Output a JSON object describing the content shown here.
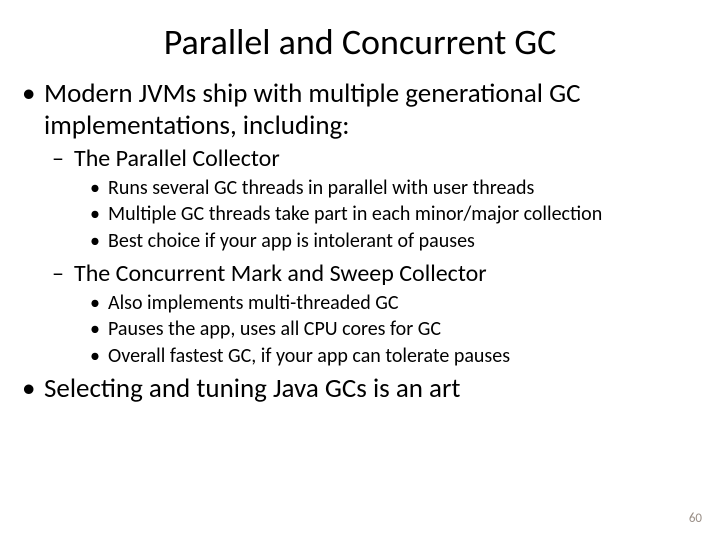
{
  "title": "Parallel and Concurrent GC",
  "bullets": {
    "b1": "Modern JVMs ship with multiple generational GC implementations, including:",
    "b1_1": "The Parallel Collector",
    "b1_1_1": "Runs several GC threads in parallel with user threads",
    "b1_1_2": "Multiple GC threads take part in each minor/major collection",
    "b1_1_3": "Best choice if your app is intolerant of pauses",
    "b1_2": "The Concurrent Mark and Sweep Collector",
    "b1_2_1": "Also implements multi-threaded GC",
    "b1_2_2": "Pauses the app, uses all CPU cores for GC",
    "b1_2_3": "Overall fastest GC, if your app can tolerate pauses",
    "b2": "Selecting and tuning Java GCs is an art"
  },
  "page_number": "60"
}
